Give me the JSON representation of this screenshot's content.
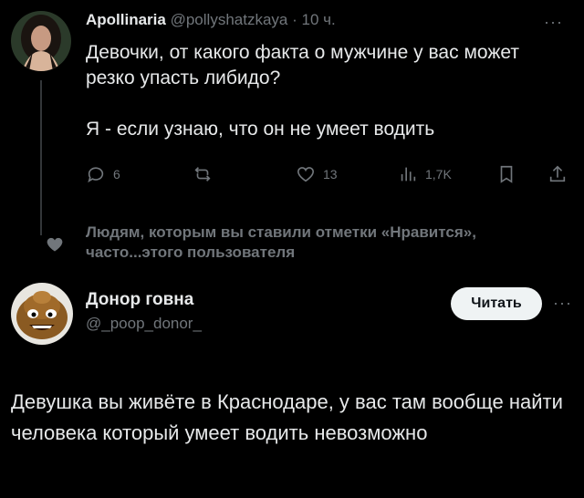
{
  "tweet1": {
    "author_name": "Apollinaria",
    "handle": "@pollyshatzkaya",
    "separator": "·",
    "time": "10 ч.",
    "more": "···",
    "text_line1": "Девочки, от какого факта о мужчине у вас может резко упасть либидо?",
    "text_line2": "Я - если узнаю, что он не умеет водить",
    "actions": {
      "reply_count": "6",
      "like_count": "13",
      "views_count": "1,7K"
    }
  },
  "liked_note": "Людям, которым вы ставили отметки «Нравится», часто...этого пользователя",
  "tweet2": {
    "author_name": "Донор говна",
    "handle": "@_poop_donor_",
    "follow_label": "Читать",
    "more": "···",
    "text": "Девушка вы живёте в Краснодаре, у вас там вообще найти человека который умеет водить невозможно"
  },
  "colors": {
    "background": "#000000",
    "text": "#e7e9ea",
    "muted": "#71767b",
    "button_bg": "#eff3f4"
  }
}
